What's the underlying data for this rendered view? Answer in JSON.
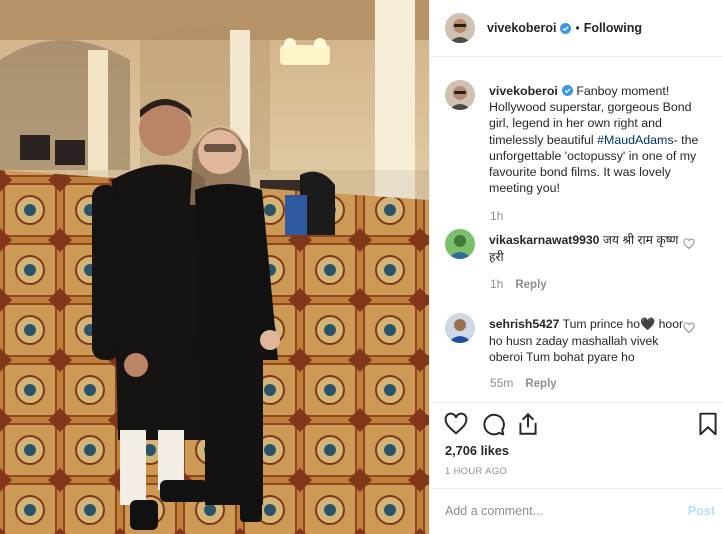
{
  "post": {
    "image_alt": "Photo of two people standing on a patterned carpet in a hotel hall",
    "author": "vivekoberoi",
    "verified": true,
    "separator": "•",
    "follow_status": "Following"
  },
  "caption": {
    "username": "vivekoberoi",
    "text_before": " Fanboy moment! Hollywood superstar, gorgeous Bond girl, legend in her own right and timelessly beautiful ",
    "hashtag": "#MaudAdams",
    "text_after": "- the unforgettable 'octopussy' in one of my favourite bond films. It was lovely meeting you!",
    "time": "1h"
  },
  "comments": [
    {
      "username": "vikaskarnawat9930",
      "text": " जय श्री राम कृष्ण हरी",
      "time": "1h",
      "reply_label": "Reply"
    },
    {
      "username": "sehrish5427",
      "text": " Tum prince ho🖤 hoor ho husn zaday mashallah vivek oberoi Tum bohat pyare ho",
      "time": "55m",
      "reply_label": "Reply"
    }
  ],
  "icons": {
    "like": "heart-icon",
    "comment": "comment-icon",
    "share": "share-icon",
    "save": "bookmark-icon",
    "verified": "verified-badge-icon",
    "comment_like": "heart-outline-icon"
  },
  "stats": {
    "likes": "2,706 likes",
    "posted_ago": "1 HOUR AGO"
  },
  "composer": {
    "placeholder": "Add a comment...",
    "post_label": "Post"
  },
  "colors": {
    "verified_blue": "#3897f0",
    "hashtag": "#003569",
    "muted": "#8e8e8e",
    "post_disabled": "#b2dffc"
  }
}
